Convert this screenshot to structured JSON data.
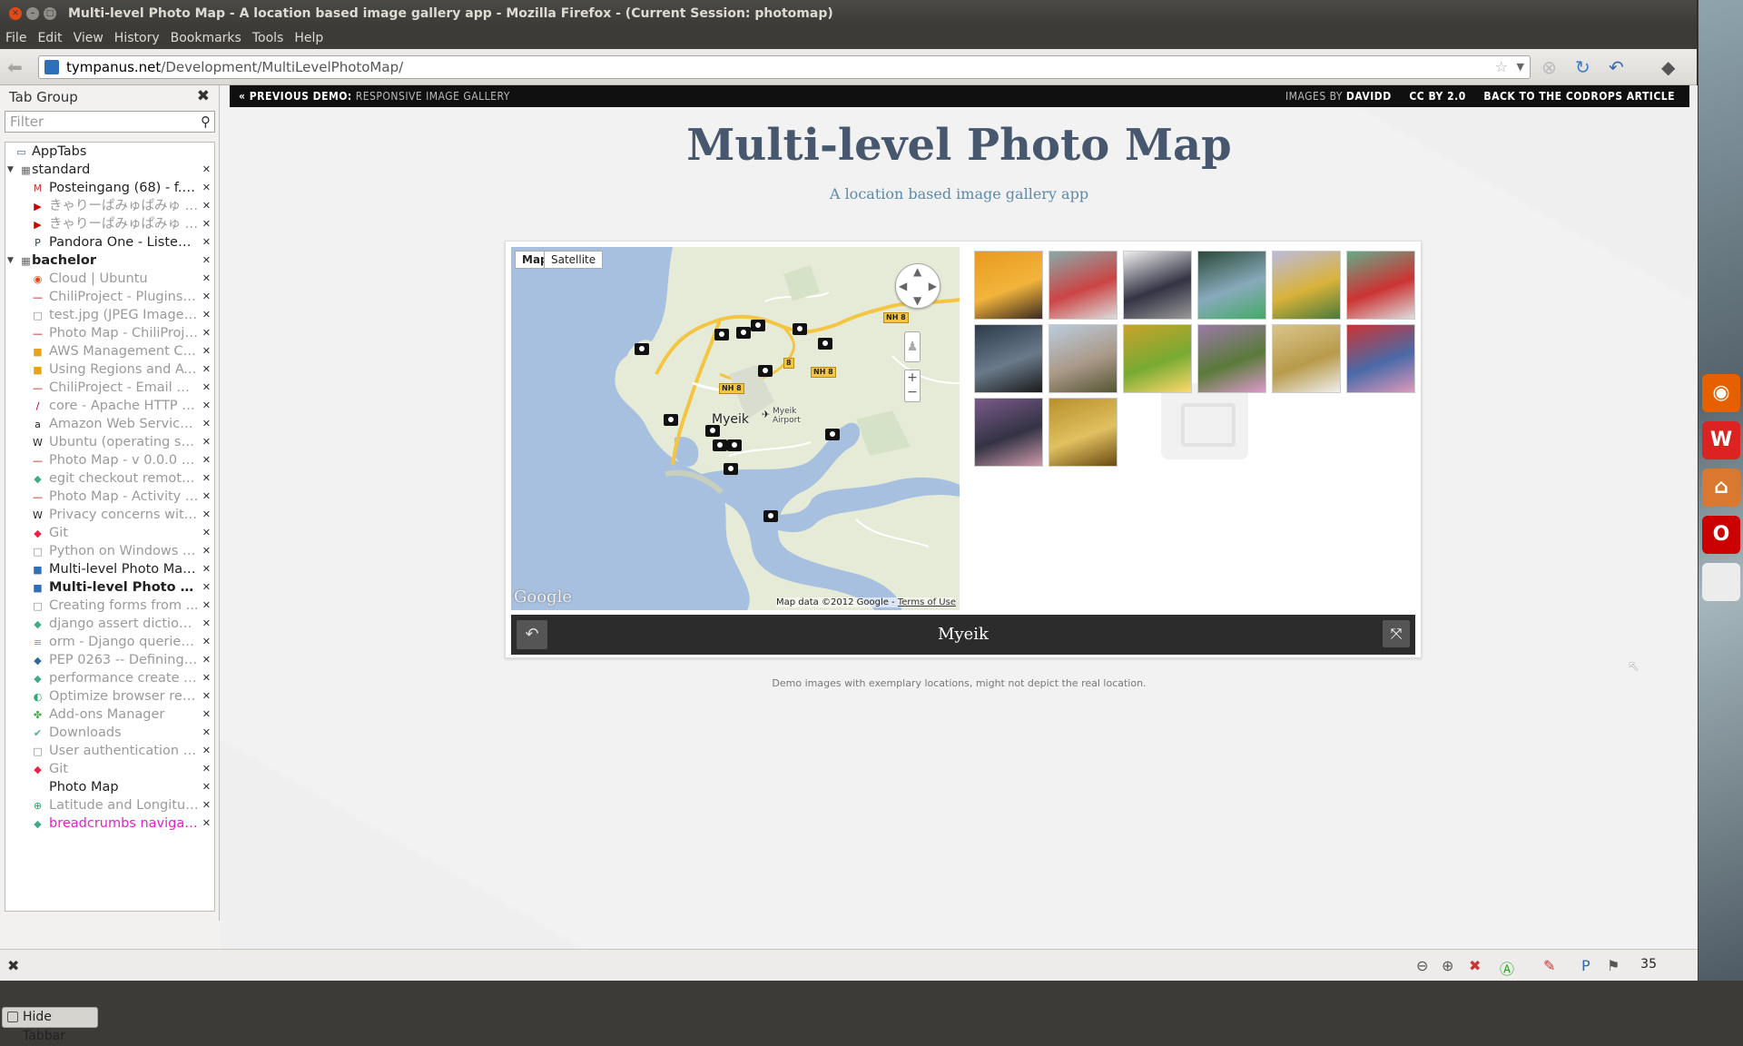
{
  "window": {
    "title": "Multi-level Photo Map - A location based image gallery app - Mozilla Firefox - (Current Session: photomap)"
  },
  "menu": [
    "File",
    "Edit",
    "View",
    "History",
    "Bookmarks",
    "Tools",
    "Help"
  ],
  "address": {
    "host": "tympanus.net",
    "path": "/Development/MultiLevelPhotoMap/"
  },
  "tabgroup": {
    "title": "Tab Group",
    "filter_placeholder": "Filter",
    "items": [
      {
        "label": "AppTabs",
        "kind": "apptabs"
      },
      {
        "label": "standard",
        "kind": "group"
      },
      {
        "label": "Posteingang (68) - f.v....",
        "icon": "M",
        "color": "#c33"
      },
      {
        "label": "きゃりーぱみゅぱみゅ - ...",
        "icon": "▶",
        "color": "#c00",
        "dim": true
      },
      {
        "label": "きゃりーぱみゅぱみゅ - P...",
        "icon": "▶",
        "color": "#c00",
        "dim": true
      },
      {
        "label": "Pandora One - Listen t...",
        "icon": "P",
        "color": "#245"
      },
      {
        "label": "bachelor",
        "kind": "group",
        "bold": true
      },
      {
        "label": "Cloud | Ubuntu",
        "icon": "◉",
        "color": "#dd4814",
        "dim": true
      },
      {
        "label": "ChiliProject - Plugins - ...",
        "icon": "—",
        "color": "#c00",
        "dim": true
      },
      {
        "label": "test.jpg (JPEG Image, ...",
        "icon": "□",
        "color": "#888",
        "dim": true
      },
      {
        "label": "Photo Map - ChiliProject",
        "icon": "—",
        "color": "#c00",
        "dim": true
      },
      {
        "label": "AWS Management Co...",
        "icon": "■",
        "color": "#e8a21b",
        "dim": true
      },
      {
        "label": "Using Regions and Av...",
        "icon": "■",
        "color": "#e8a21b",
        "dim": true
      },
      {
        "label": "ChiliProject - Email De...",
        "icon": "—",
        "color": "#c00",
        "dim": true
      },
      {
        "label": "core - Apache HTTP Se...",
        "icon": "/",
        "color": "#a03",
        "dim": true
      },
      {
        "label": "Amazon Web Services...",
        "icon": "a",
        "color": "#222",
        "dim": true
      },
      {
        "label": "Ubuntu (operating sys...",
        "icon": "W",
        "color": "#222",
        "dim": true
      },
      {
        "label": "Photo Map - v 0.0.0 - C...",
        "icon": "—",
        "color": "#c00",
        "dim": true
      },
      {
        "label": "egit checkout remote ...",
        "icon": "◆",
        "color": "#4a8",
        "dim": true
      },
      {
        "label": "Photo Map - Activity - ...",
        "icon": "—",
        "color": "#c00",
        "dim": true
      },
      {
        "label": "Privacy concerns with ...",
        "icon": "W",
        "color": "#222",
        "dim": true
      },
      {
        "label": "Git",
        "icon": "◆",
        "color": "#e24",
        "dim": true
      },
      {
        "label": "Python on Windows F...",
        "icon": "□",
        "color": "#888",
        "dim": true
      },
      {
        "label": "Multi-level Photo Map...",
        "icon": "■",
        "color": "#2f6fb8"
      },
      {
        "label": "Multi-level Photo M...",
        "icon": "■",
        "color": "#2f6fb8",
        "bold": true
      },
      {
        "label": "Creating forms from ...",
        "icon": "□",
        "color": "#888",
        "dim": true
      },
      {
        "label": "django assert diction...",
        "icon": "◆",
        "color": "#4a8",
        "dim": true
      },
      {
        "label": "orm - Django queries - ...",
        "icon": "≡",
        "color": "#c84",
        "dim": true
      },
      {
        "label": "PEP 0263 -- Defining P...",
        "icon": "◆",
        "color": "#369",
        "dim": true
      },
      {
        "label": "performance create t...",
        "icon": "◆",
        "color": "#4a8",
        "dim": true
      },
      {
        "label": "Optimize browser ren...",
        "icon": "◐",
        "color": "#3a7",
        "dim": true
      },
      {
        "label": "Add-ons Manager",
        "icon": "✤",
        "color": "#4a4",
        "dim": true
      },
      {
        "label": "Downloads",
        "icon": "✔",
        "color": "#5a8",
        "dim": true
      },
      {
        "label": "User authentication in...",
        "icon": "□",
        "color": "#888",
        "dim": true
      },
      {
        "label": "Git",
        "icon": "◆",
        "color": "#e24",
        "dim": true
      },
      {
        "label": "Photo Map",
        "icon": "",
        "color": "#888"
      },
      {
        "label": "Latitude and Longitud...",
        "icon": "⊕",
        "color": "#2a6",
        "dim": true
      },
      {
        "label": "breadcrumbs navigati...",
        "icon": "◆",
        "color": "#4a8",
        "pink": true
      }
    ],
    "hide_label": "Hide Tabbar"
  },
  "codrops": {
    "prev_label": "« PREVIOUS DEMO:",
    "prev_name": "RESPONSIVE IMAGE GALLERY",
    "images_by": "IMAGES BY",
    "author": "DAVIDD",
    "license": "CC BY 2.0",
    "back": "BACK TO THE CODROPS ARTICLE"
  },
  "page": {
    "title": "Multi-level Photo Map",
    "subtitle": "A location based image gallery app",
    "note": "Demo images with exemplary locations, might not depict the real location."
  },
  "map": {
    "type_map": "Map",
    "type_satellite": "Satellite",
    "city": "Myeik",
    "airport": "Myeik Airport",
    "road1": "NH 8",
    "road2": "8",
    "road3": "NH 8",
    "road4": "NH 8",
    "attribution": "Map data ©2012 Google -",
    "terms": "Terms of Use",
    "logo": "Google"
  },
  "gallery": {
    "thumbs": [
      {
        "name": "monk",
        "colors": [
          "#e89a1e",
          "#f2b43c",
          "#3a2a20"
        ]
      },
      {
        "name": "street-crowd",
        "colors": [
          "#8aa",
          "#c44",
          "#ddd"
        ]
      },
      {
        "name": "school-children",
        "colors": [
          "#eee",
          "#334",
          "#999"
        ]
      },
      {
        "name": "fountain",
        "colors": [
          "#2c4a3a",
          "#8ab",
          "#4a6"
        ]
      },
      {
        "name": "golden-pagoda",
        "colors": [
          "#bbd",
          "#d9b23a",
          "#4a7a3a"
        ]
      },
      {
        "name": "market-stall",
        "colors": [
          "#6a8",
          "#c33",
          "#ddd"
        ]
      },
      {
        "name": "guardian-statue",
        "colors": [
          "#2c3a4a",
          "#6a7a8a",
          "#1a1a1a"
        ]
      },
      {
        "name": "temple-crowd",
        "colors": [
          "#bcd",
          "#a98",
          "#553"
        ]
      },
      {
        "name": "gold-ornament",
        "colors": [
          "#c9a22a",
          "#7a3",
          "#ffd86a"
        ]
      },
      {
        "name": "lotus",
        "colors": [
          "#9a7aa8",
          "#5a7a3a",
          "#d9c"
        ]
      },
      {
        "name": "golden-figure",
        "colors": [
          "#d9c48a",
          "#b89a4a",
          "#eee"
        ]
      },
      {
        "name": "red-guardian",
        "colors": [
          "#c33",
          "#4a6aa8",
          "#d9b"
        ]
      },
      {
        "name": "visitors",
        "colors": [
          "#7a5a8a",
          "#334",
          "#c9a"
        ]
      },
      {
        "name": "golden-relief",
        "colors": [
          "#b8902a",
          "#e0c060",
          "#6a4a10"
        ]
      }
    ]
  },
  "viewer": {
    "location": "Myeik"
  },
  "statusbar": {
    "zoom_value": "35"
  },
  "dock": [
    {
      "name": "firefox-icon",
      "color": "#e66000",
      "glyph": "◉"
    },
    {
      "name": "w-icon",
      "color": "#d22",
      "glyph": "W"
    },
    {
      "name": "home-folder-icon",
      "color": "#d9782e",
      "glyph": "⌂"
    },
    {
      "name": "opera-icon",
      "color": "#c00",
      "glyph": "O"
    },
    {
      "name": "text-editor-icon",
      "color": "#ececec",
      "glyph": ""
    }
  ]
}
